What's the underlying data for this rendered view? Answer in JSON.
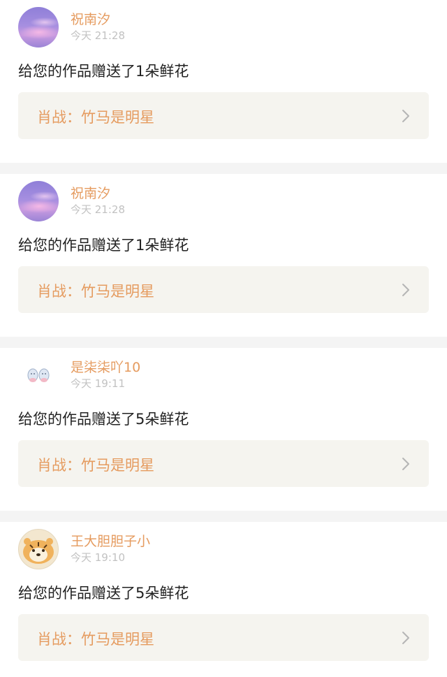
{
  "notifications": [
    {
      "avatar_icon": "purple-sky-avatar",
      "username": "祝南汐",
      "time": "今天 21:28",
      "message": "给您的作品赠送了1朵鲜花",
      "work_title": "肖战：竹马是明星"
    },
    {
      "avatar_icon": "purple-sky-avatar",
      "username": "祝南汐",
      "time": "今天 21:28",
      "message": "给您的作品赠送了1朵鲜花",
      "work_title": "肖战：竹马是明星"
    },
    {
      "avatar_icon": "cartoon-figures-avatar",
      "username": "是柒柒吖10",
      "time": "今天 19:11",
      "message": "给您的作品赠送了5朵鲜花",
      "work_title": "肖战：竹马是明星"
    },
    {
      "avatar_icon": "tiger-avatar",
      "username": "王大胆胆子小",
      "time": "今天 19:10",
      "message": "给您的作品赠送了5朵鲜花",
      "work_title": "肖战：竹马是明星"
    }
  ],
  "colors": {
    "accent": "#e59b5f",
    "link_background": "#f5f4ef",
    "separator": "#f4f4f4",
    "time_text": "#c2c2c2",
    "message_text": "#222222"
  }
}
